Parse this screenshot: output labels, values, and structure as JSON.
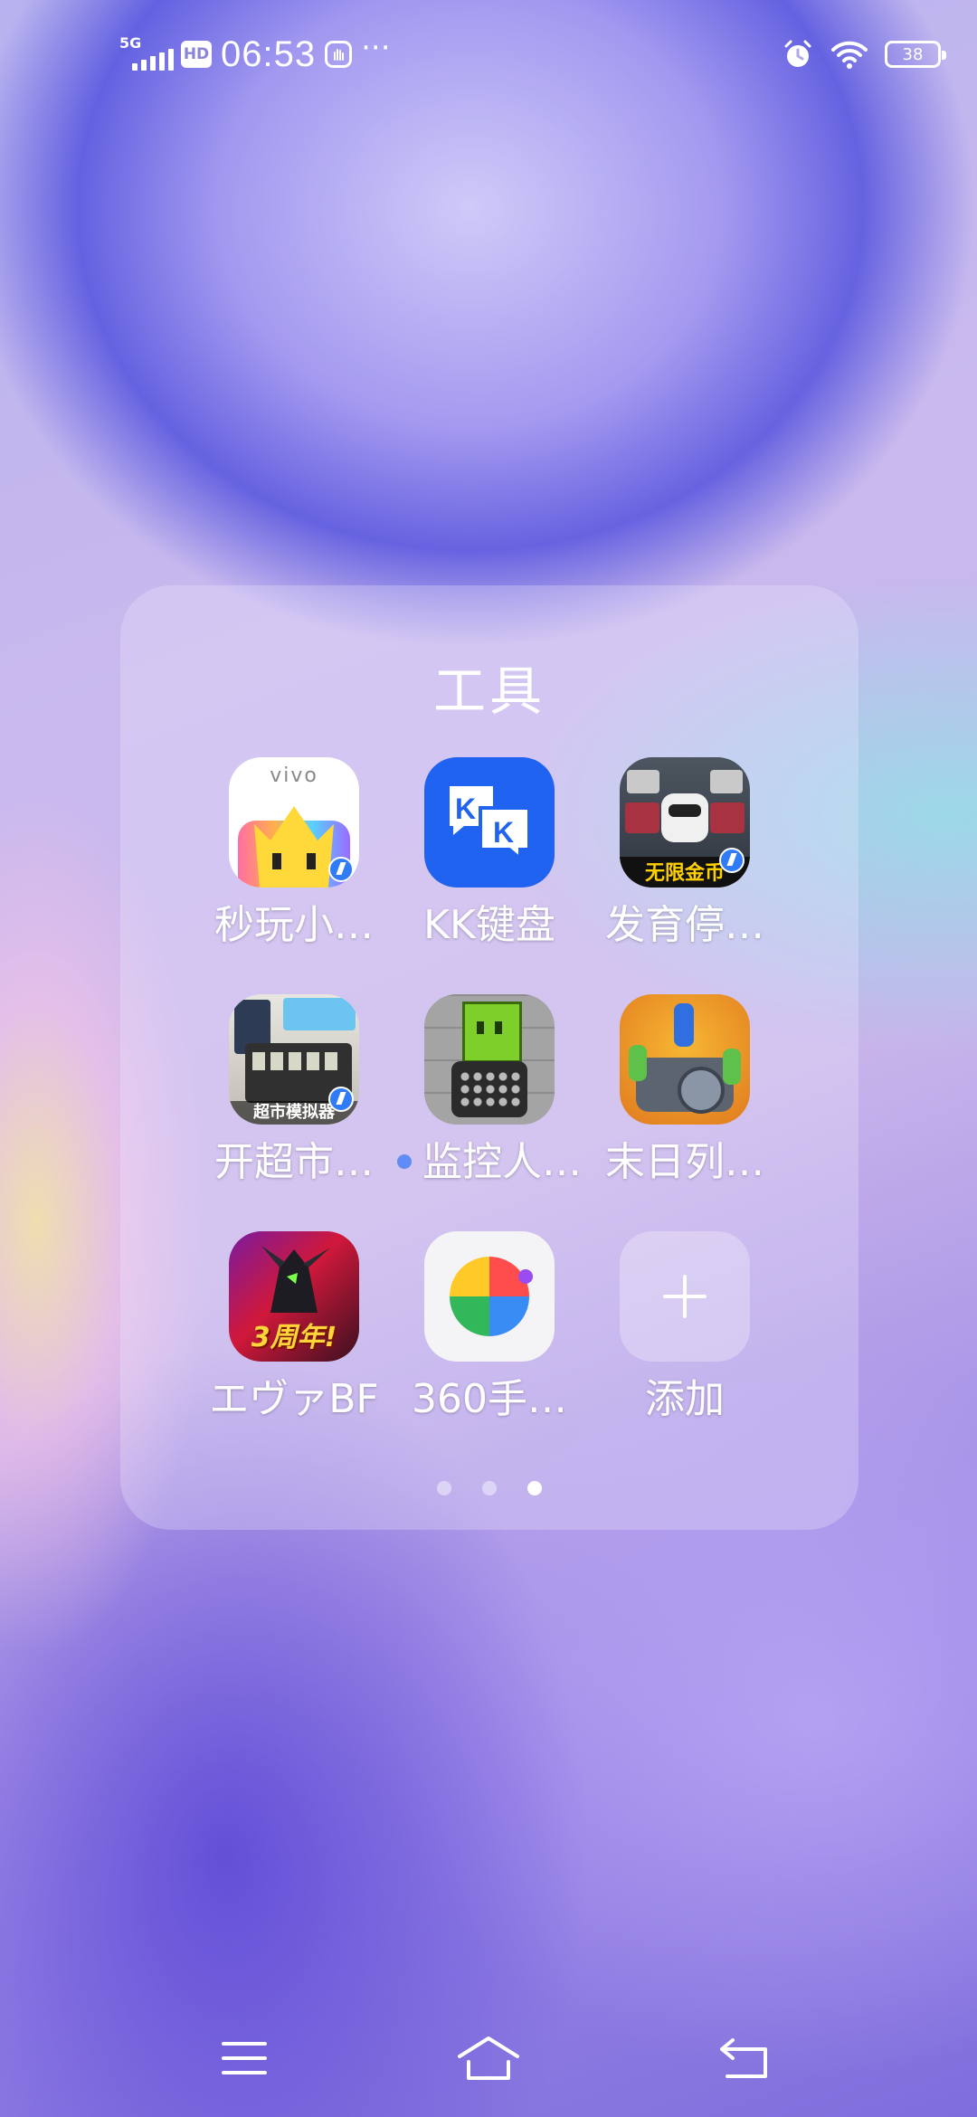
{
  "status_bar": {
    "network": "5G",
    "hd_label": "HD",
    "time": "06:53",
    "more": "···",
    "battery": "38",
    "icons": [
      "signal-icon",
      "hd-icon",
      "accessibility-icon",
      "alarm-icon",
      "wifi-icon",
      "battery-icon"
    ]
  },
  "folder": {
    "title": "工具",
    "apps": [
      {
        "label": "秒玩小…",
        "icon": "vivo-quickgame-icon"
      },
      {
        "label": "KK键盘",
        "icon": "kk-keyboard-icon"
      },
      {
        "label": "发育停…",
        "icon": "game-idle-icon"
      },
      {
        "label": "开超市…",
        "icon": "supermarket-game-icon"
      },
      {
        "label": "监控人…",
        "icon": "camera-robot-game-icon",
        "new": true
      },
      {
        "label": "末日列…",
        "icon": "doomsday-train-game-icon"
      },
      {
        "label": "エヴァBF",
        "icon": "eva-bf-game-icon"
      },
      {
        "label": "360手…",
        "icon": "360-assistant-icon"
      },
      {
        "label": "添加",
        "icon": "add-icon"
      }
    ],
    "icon_text": {
      "vivo": "vivo",
      "unlimited_gold": "无限金币",
      "supermarket": "超市模拟器",
      "anniversary": "3周年!"
    },
    "page_count": 3,
    "current_page": 3
  },
  "colors": {
    "folder_bg": "rgba(240,238,255,0.28)",
    "kk_blue": "#1f63f0",
    "page_active": "#ffffff",
    "new_dot": "#5f8cf5"
  },
  "nav_bar": {
    "buttons": [
      "menu-icon",
      "home-icon",
      "back-icon"
    ]
  }
}
